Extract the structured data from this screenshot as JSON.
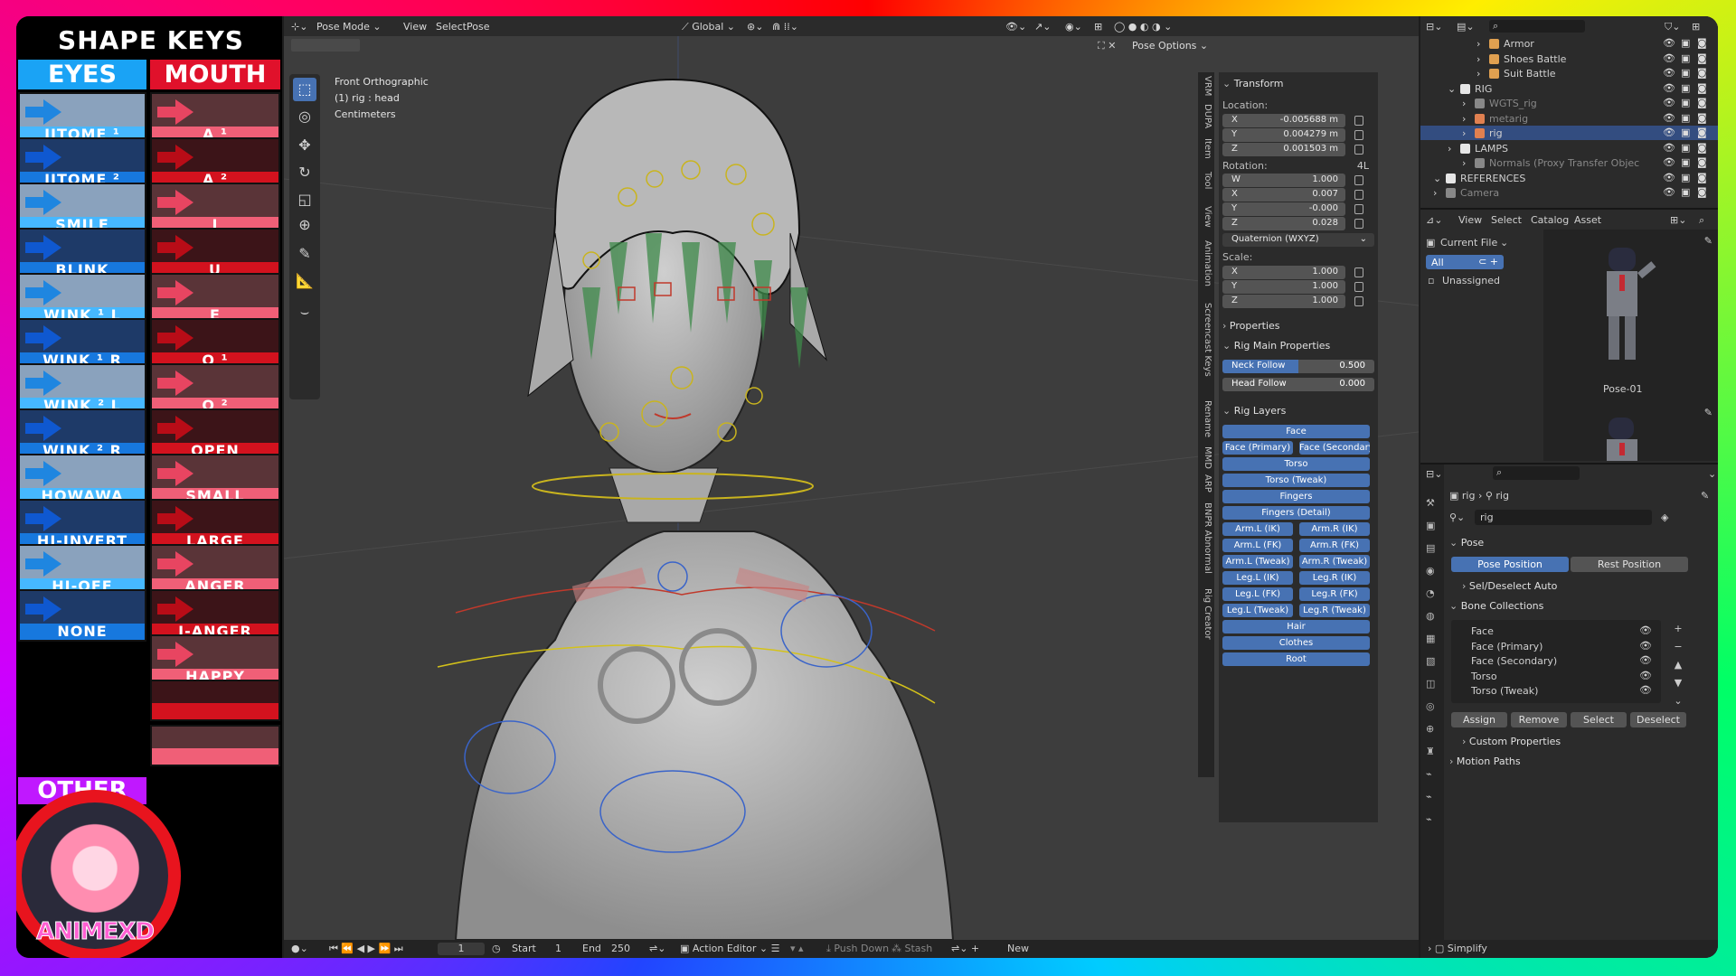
{
  "shape_keys": {
    "title": "SHAPE KEYS",
    "eyes_header": "EYES",
    "mouth_header": "MOUTH",
    "other_header": "OTHER",
    "eyes": [
      "JITOME ¹",
      "JITOME ²",
      "SMILE",
      "BLINK",
      "WINK ¹ L",
      "WINK ¹ R",
      "WINK ² L",
      "WINK ² R",
      "HOWAWA",
      "HI-INVERT",
      "HI-OFF",
      "NONE"
    ],
    "mouth": [
      "A ¹",
      "A ²",
      "I",
      "U",
      "E",
      "O ¹",
      "O ²",
      "OPEN",
      "SMALL",
      "LARGE",
      "ANGER",
      "I-ANGER",
      "HAPPY",
      "",
      ""
    ]
  },
  "logo": {
    "text": "ANIMEXD"
  },
  "viewport": {
    "mode": "Pose Mode",
    "menus": [
      "View",
      "Select",
      "Pose"
    ],
    "orientation": "Global",
    "pose_options": "Pose Options",
    "info": [
      "Front Orthographic",
      "(1) rig : head",
      "Centimeters"
    ]
  },
  "npanel": {
    "transform": "Transform",
    "location_label": "Location:",
    "location": [
      {
        "k": "X",
        "v": "-0.005688 m"
      },
      {
        "k": "Y",
        "v": "0.004279 m"
      },
      {
        "k": "Z",
        "v": "0.001503 m"
      }
    ],
    "rotation_label": "Rotation:",
    "rotation_mode_short": "4L",
    "rotation": [
      {
        "k": "W",
        "v": "1.000"
      },
      {
        "k": "X",
        "v": "0.007"
      },
      {
        "k": "Y",
        "v": "-0.000"
      },
      {
        "k": "Z",
        "v": "0.028"
      }
    ],
    "rotation_mode": "Quaternion (WXYZ)",
    "scale_label": "Scale:",
    "scale": [
      {
        "k": "X",
        "v": "1.000"
      },
      {
        "k": "Y",
        "v": "1.000"
      },
      {
        "k": "Z",
        "v": "1.000"
      }
    ],
    "properties": "Properties",
    "rig_main": "Rig Main Properties",
    "neck_follow": {
      "label": "Neck Follow",
      "value": "0.500",
      "fraction": 0.5
    },
    "head_follow": {
      "label": "Head Follow",
      "value": "0.000",
      "fraction": 0.0
    },
    "rig_layers": "Rig Layers",
    "layers": [
      [
        "Face"
      ],
      [
        "Face (Primary)",
        "Face (Secondary)"
      ],
      [
        "Torso"
      ],
      [
        "Torso (Tweak)"
      ],
      [
        "Fingers"
      ],
      [
        "Fingers (Detail)"
      ],
      [
        "Arm.L (IK)",
        "Arm.R (IK)"
      ],
      [
        "Arm.L (FK)",
        "Arm.R (FK)"
      ],
      [
        "Arm.L (Tweak)",
        "Arm.R (Tweak)"
      ],
      [
        "Leg.L (IK)",
        "Leg.R (IK)"
      ],
      [
        "Leg.L (FK)",
        "Leg.R (FK)"
      ],
      [
        "Leg.L (Tweak)",
        "Leg.R (Tweak)"
      ],
      [
        "Hair"
      ],
      [
        "Clothes"
      ],
      [
        "Root"
      ]
    ]
  },
  "side_tabs": [
    "VRM",
    "DUPA",
    "Item",
    "Tool",
    "View",
    "Animation",
    "Screencast Keys",
    "Rename",
    "MMD",
    "ARP",
    "BNPR Abnormal",
    "Rig Creator"
  ],
  "timeline": {
    "start_label": "Start",
    "start": "1",
    "end_label": "End",
    "end": "250",
    "frame": "1",
    "editor": "Action Editor",
    "push_down": "Push Down",
    "stash": "Stash",
    "new": "New"
  },
  "outliner": {
    "rows": [
      "Armor",
      "Shoes Battle",
      "Suit Battle",
      "RIG",
      "WGTS_rig",
      "metarig",
      "rig",
      "LAMPS",
      "Normals (Proxy Transfer Objec",
      "REFERENCES",
      "Camera"
    ]
  },
  "asset_browser": {
    "menus": [
      "View",
      "Select",
      "Catalog",
      "Asset"
    ],
    "library": "Current File",
    "catalogs": [
      "All",
      "Unassigned"
    ],
    "asset": "Pose-01"
  },
  "properties": {
    "breadcrumb": [
      "rig",
      "rig"
    ],
    "object_name": "rig",
    "pose": "Pose",
    "pose_position": "Pose Position",
    "rest_position": "Rest Position",
    "sel_deselect": "Sel/Deselect Auto",
    "bone_collections": "Bone Collections",
    "collections": [
      "Face",
      "Face (Primary)",
      "Face (Secondary)",
      "Torso",
      "Torso (Tweak)"
    ],
    "actions": [
      "Assign",
      "Remove",
      "Select",
      "Deselect"
    ],
    "custom": "Custom Properties",
    "motion_paths": "Motion Paths",
    "simplify": "Simplify"
  },
  "colors": {
    "accent": "#4772b3",
    "eyes_blue": "#1aa3f5",
    "mouth_red": "#e0112b",
    "other_purple": "#c018ff"
  }
}
